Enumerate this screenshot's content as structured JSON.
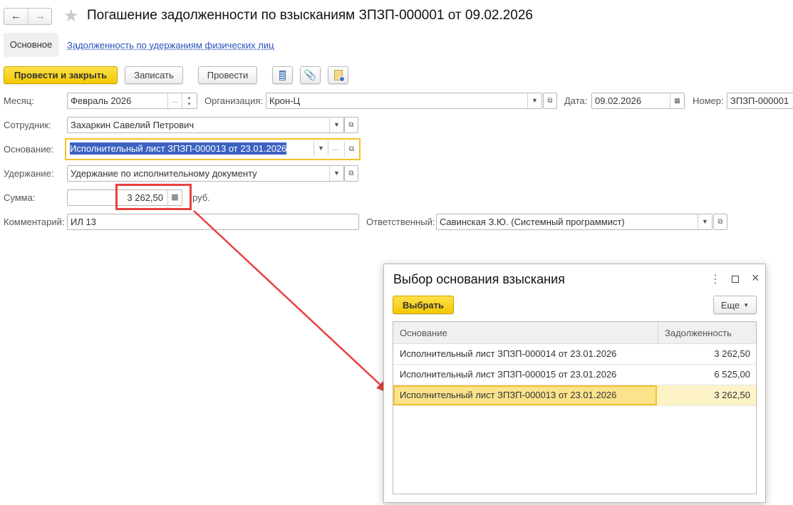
{
  "header": {
    "title": "Погашение задолженности по взысканиям ЗПЗП-000001 от 09.02.2026"
  },
  "tabs": [
    {
      "label": "Основное"
    },
    {
      "label": "Задолженность по удержаниям физических лиц"
    }
  ],
  "toolbar": {
    "post_close": "Провести и закрыть",
    "save": "Записать",
    "post": "Провести"
  },
  "form": {
    "month_label": "Месяц:",
    "month": "Февраль 2026",
    "org_label": "Организация:",
    "org": "Крон-Ц",
    "date_label": "Дата:",
    "date": "09.02.2026",
    "number_label": "Номер:",
    "number": "ЗПЗП-000001",
    "employee_label": "Сотрудник:",
    "employee": "Захаркин Савелий Петрович",
    "basis_label": "Основание:",
    "basis": "Исполнительный лист ЗПЗП-000013 от 23.01.2026",
    "deduction_label": "Удержание:",
    "deduction": "Удержание по исполнительному документу",
    "sum_label": "Сумма:",
    "sum": "3 262,50",
    "currency": "руб.",
    "comment_label": "Комментарий:",
    "comment": "ИЛ 13",
    "responsible_label": "Ответственный:",
    "responsible": "Савинская З.Ю. (Системный программист)"
  },
  "dialog": {
    "title": "Выбор основания взыскания",
    "select": "Выбрать",
    "more": "Еще",
    "columns": [
      "Основание",
      "Задолженность"
    ],
    "rows": [
      {
        "basis": "Исполнительный лист ЗПЗП-000014 от 23.01.2026",
        "debt": "3 262,50"
      },
      {
        "basis": "Исполнительный лист ЗПЗП-000015 от 23.01.2026",
        "debt": "6 525,00"
      },
      {
        "basis": "Исполнительный лист ЗПЗП-000013 от 23.01.2026",
        "debt": "3 262,50"
      }
    ]
  },
  "colors": {
    "accent": "#f3c900",
    "highlight": "#fbe38c",
    "annotation": "#e8403f",
    "selection": "#3a62c2"
  }
}
